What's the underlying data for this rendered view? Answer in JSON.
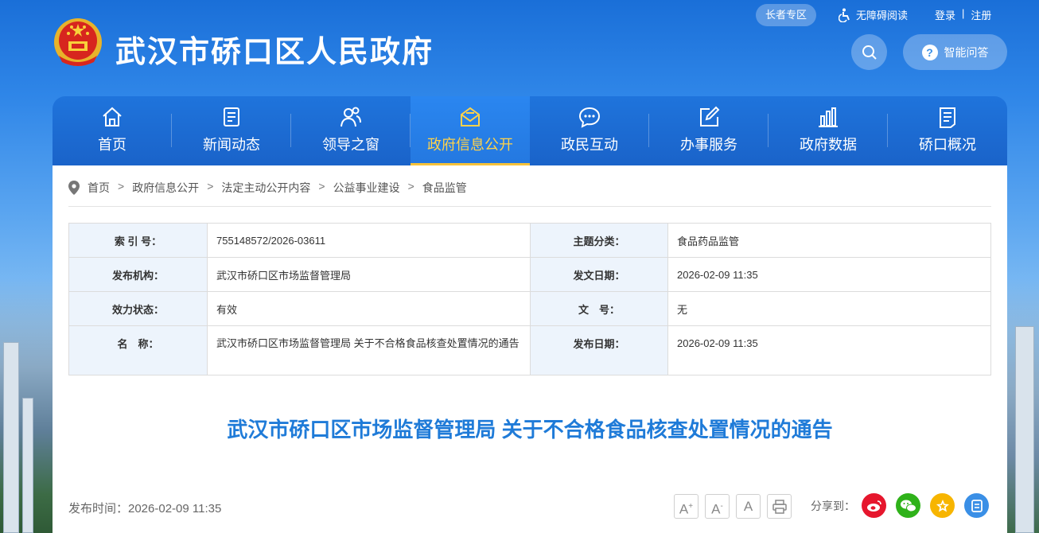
{
  "header": {
    "site_title": "武汉市硚口区人民政府",
    "elder_zone": "长者专区",
    "accessibility": "无障碍阅读",
    "login": "登录",
    "divider": "|",
    "register": "注册",
    "qa_button": "智能问答",
    "qa_glyph": "?"
  },
  "nav": {
    "items": [
      {
        "label": "首页",
        "icon": "home-icon"
      },
      {
        "label": "新闻动态",
        "icon": "news-icon"
      },
      {
        "label": "领导之窗",
        "icon": "leaders-icon"
      },
      {
        "label": "政府信息公开",
        "icon": "mail-icon",
        "active": true
      },
      {
        "label": "政民互动",
        "icon": "chat-icon"
      },
      {
        "label": "办事服务",
        "icon": "edit-icon"
      },
      {
        "label": "政府数据",
        "icon": "bar-chart-icon"
      },
      {
        "label": "硚口概况",
        "icon": "document-icon"
      }
    ]
  },
  "breadcrumb": [
    "首页",
    "政府信息公开",
    "法定主动公开内容",
    "公益事业建设",
    "食品监管"
  ],
  "breadcrumb_sep": ">",
  "meta": {
    "index_label": "索 引 号：",
    "index_value": "755148572/2026-03611",
    "topic_label": "主题分类：",
    "topic_value": "食品药品监管",
    "publisher_label": "发布机构：",
    "publisher_value": "武汉市硚口区市场监督管理局",
    "doc_date_label": "发文日期：",
    "doc_date_value": "2026-02-09 11:35",
    "status_label": "效力状态：",
    "status_value": "有效",
    "docno_label": "文　号：",
    "docno_value": "无",
    "name_label": "名　称：",
    "name_value": "武汉市硚口区市场监督管理局 关于不合格食品核查处置情况的通告",
    "pub_date_label": "发布日期：",
    "pub_date_value": "2026-02-09 11:35"
  },
  "article": {
    "title": "武汉市硚口区市场监督管理局 关于不合格食品核查处置情况的通告",
    "publish_time": "发布时间：2026-02-09 11:35"
  },
  "tools": {
    "font_large": "A",
    "font_large_mark": "+",
    "font_small": "A",
    "font_small_mark": "-",
    "font_default": "A"
  },
  "share": {
    "label": "分享到：",
    "targets": [
      "weibo-icon",
      "wechat-icon",
      "qzone-icon",
      "copy-icon"
    ]
  },
  "colors": {
    "nav_bg": "#1a63c9",
    "nav_active_text": "#ffd24a",
    "nav_active_underline": "#f6c23a",
    "title_blue": "#1f7bd8",
    "label_bg": "#edf4fc",
    "weibo": "#e6162d",
    "wechat": "#2fb21a",
    "qzone": "#f7b500",
    "copy": "#3a8fe6"
  }
}
